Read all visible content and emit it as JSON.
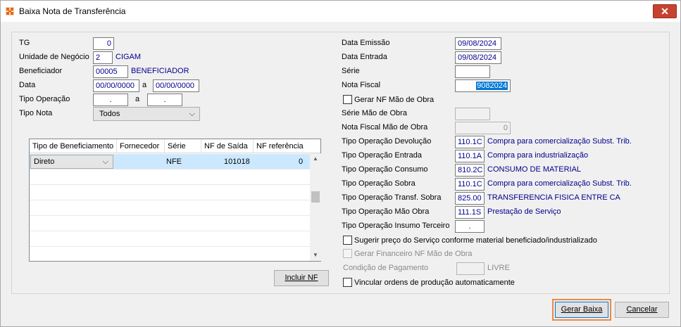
{
  "window": {
    "title": "Baixa Nota de Transferência",
    "close_glyph": "✕"
  },
  "left": {
    "tg": {
      "label": "TG",
      "value": "0"
    },
    "unidade": {
      "label": "Unidade de Negócio",
      "value": "2",
      "desc": "CIGAM"
    },
    "beneficiador": {
      "label": "Beneficiador",
      "value": "00005",
      "desc": "BENEFICIADOR"
    },
    "data": {
      "label": "Data",
      "from": "00/00/0000",
      "sep": "a",
      "to": "00/00/0000"
    },
    "tipo_operacao": {
      "label": "Tipo Operação",
      "from": ".",
      "sep": "a",
      "to": "."
    },
    "tipo_nota": {
      "label": "Tipo Nota",
      "value": "Todos"
    }
  },
  "grid": {
    "columns": [
      "Tipo de Beneficiamento",
      "Fornecedor",
      "Série",
      "NF de Saída",
      "NF referência"
    ],
    "rows": [
      {
        "tipo": "Direto",
        "fornecedor": "",
        "serie": "NFE",
        "nf_saida": "101018",
        "nf_ref": "0"
      }
    ]
  },
  "buttons": {
    "incluir_nf": "Incluir NF",
    "gerar_baixa": "Gerar Baixa",
    "cancelar": "Cancelar"
  },
  "right": {
    "data_emissao": {
      "label": "Data Emissão",
      "value": "09/08/2024"
    },
    "data_entrada": {
      "label": "Data Entrada",
      "value": "09/08/2024"
    },
    "serie": {
      "label": "Série",
      "value": ""
    },
    "nota_fiscal": {
      "label": "Nota Fiscal",
      "value": "9082024"
    },
    "gerar_nf_mao_obra": "Gerar NF Mão de Obra",
    "serie_mao_obra": {
      "label": "Série Mão de Obra",
      "value": ""
    },
    "nf_mao_obra": {
      "label": "Nota Fiscal Mão de Obra",
      "value": "0"
    },
    "op_devolucao": {
      "label": "Tipo Operação Devolução",
      "value": "110.1C",
      "desc": "Compra para comercialização Subst. Trib."
    },
    "op_entrada": {
      "label": "Tipo Operação Entrada",
      "value": "110.1A",
      "desc": "Compra para industrialização"
    },
    "op_consumo": {
      "label": "Tipo Operação Consumo",
      "value": "810.2C",
      "desc": "CONSUMO DE MATERIAL"
    },
    "op_sobra": {
      "label": "Tipo Operação Sobra",
      "value": "110.1C",
      "desc": "Compra para comercialização Subst. Trib."
    },
    "op_transf_sobra": {
      "label": "Tipo Operação Transf. Sobra",
      "value": "825.00",
      "desc": "TRANSFERENCIA FISICA ENTRE CA"
    },
    "op_mao_obra": {
      "label": "Tipo Operação Mão Obra",
      "value": "111.1S",
      "desc": "Prestação de Serviço"
    },
    "op_insumo": {
      "label": "Tipo Operação Insumo Terceiro",
      "value": "."
    },
    "sugerir_preco": "Sugerir preço do Serviço conforme material beneficiado/industrializado",
    "gerar_financeiro": "Gerar Financeiro NF Mão de Obra",
    "condicao": {
      "label": "Condição de Pagamento",
      "value": "",
      "desc": "LIVRE"
    },
    "vincular": "Vincular ordens de produção automaticamente"
  }
}
